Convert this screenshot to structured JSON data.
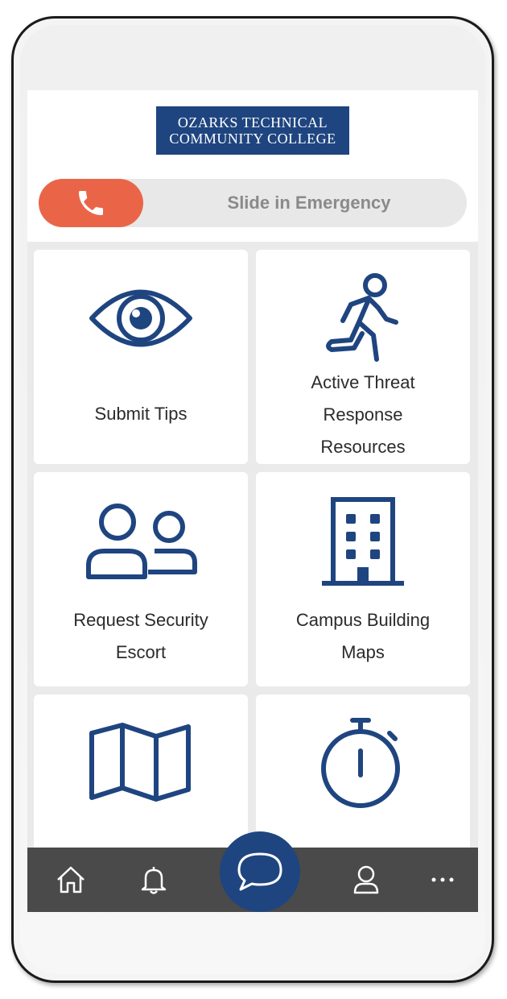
{
  "logo": {
    "line1": "OZARKS TECHNICAL",
    "line2": "COMMUNITY COLLEGE"
  },
  "emergency": {
    "label": "Slide in Emergency",
    "icon": "phone-icon",
    "accent": "#ea6548"
  },
  "tiles": [
    {
      "icon": "eye-icon",
      "label_lines": [
        "Submit Tips"
      ]
    },
    {
      "icon": "running-person-icon",
      "label_lines": [
        "Active Threat",
        "Response",
        "Resources"
      ]
    },
    {
      "icon": "people-icon",
      "label_lines": [
        "Request Security",
        "Escort"
      ]
    },
    {
      "icon": "building-icon",
      "label_lines": [
        "Campus Building",
        "Maps"
      ]
    },
    {
      "icon": "map-icon",
      "label_lines": []
    },
    {
      "icon": "stopwatch-icon",
      "label_lines": []
    }
  ],
  "nav": [
    "home-icon",
    "bell-icon",
    "chat-icon",
    "user-icon",
    "more-icon"
  ],
  "colors": {
    "brand": "#1f4580",
    "nav_bg": "#4a4a4a"
  }
}
